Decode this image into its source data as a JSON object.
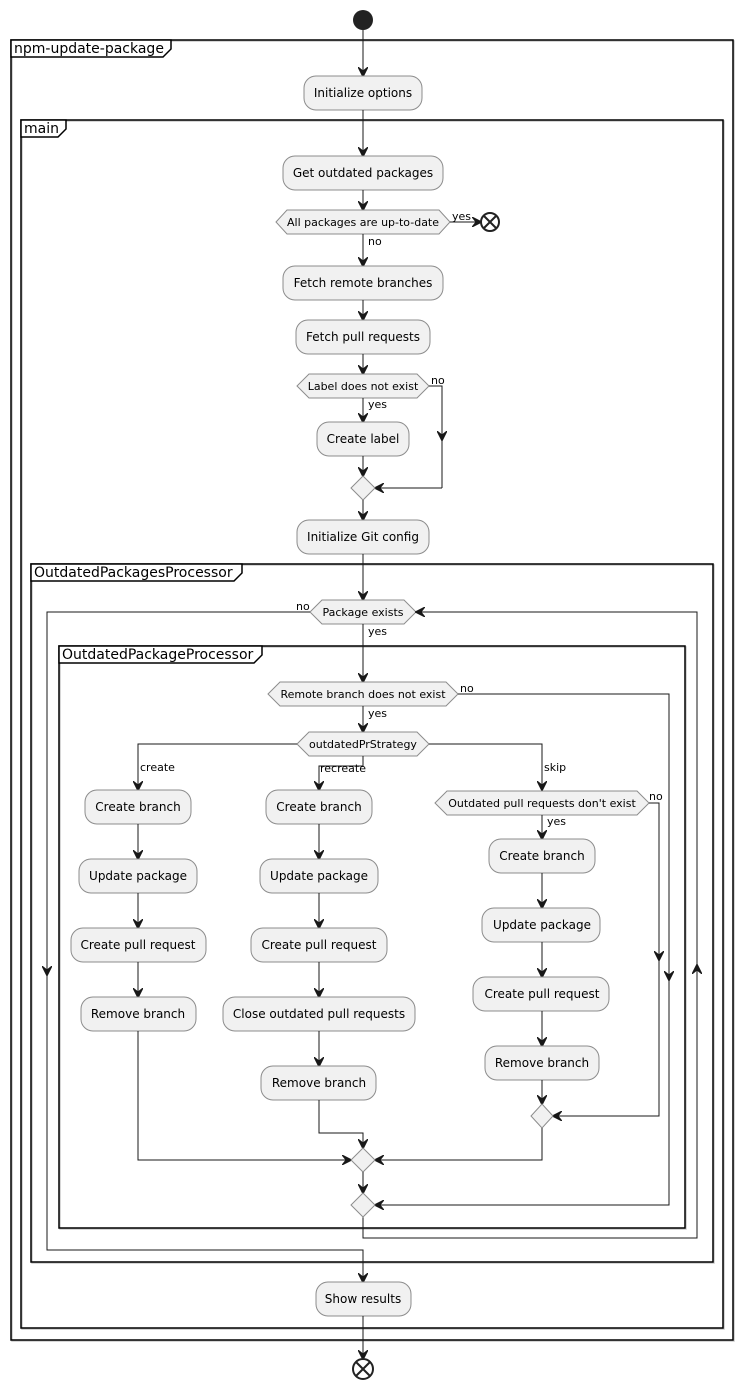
{
  "diagram": {
    "type": "activity",
    "frames": {
      "outer": "npm-update-package",
      "main": "main",
      "packages_processor": "OutdatedPackagesProcessor",
      "package_processor": "OutdatedPackageProcessor"
    },
    "actions": {
      "initialize_options": "Initialize options",
      "get_outdated": "Get outdated packages",
      "fetch_branches": "Fetch remote branches",
      "fetch_prs": "Fetch pull requests",
      "create_label": "Create label",
      "init_git": "Initialize Git config",
      "create": {
        "create_branch": "Create branch",
        "update_package": "Update package",
        "create_pr": "Create pull request",
        "remove_branch": "Remove branch"
      },
      "recreate": {
        "create_branch": "Create branch",
        "update_package": "Update package",
        "create_pr": "Create pull request",
        "close_outdated": "Close outdated pull requests",
        "remove_branch": "Remove branch"
      },
      "skip": {
        "create_branch": "Create branch",
        "update_package": "Update package",
        "create_pr": "Create pull request",
        "remove_branch": "Remove branch"
      },
      "show_results": "Show results"
    },
    "decisions": {
      "all_up_to_date": "All packages are up-to-date",
      "label_missing": "Label does not exist",
      "package_exists": "Package exists",
      "remote_branch_missing": "Remote branch does not exist",
      "strategy": "outdatedPrStrategy",
      "outdated_prs_missing": "Outdated pull requests don't exist"
    },
    "labels": {
      "yes": "yes",
      "no": "no",
      "create": "create",
      "recreate": "recreate",
      "skip": "skip"
    }
  }
}
